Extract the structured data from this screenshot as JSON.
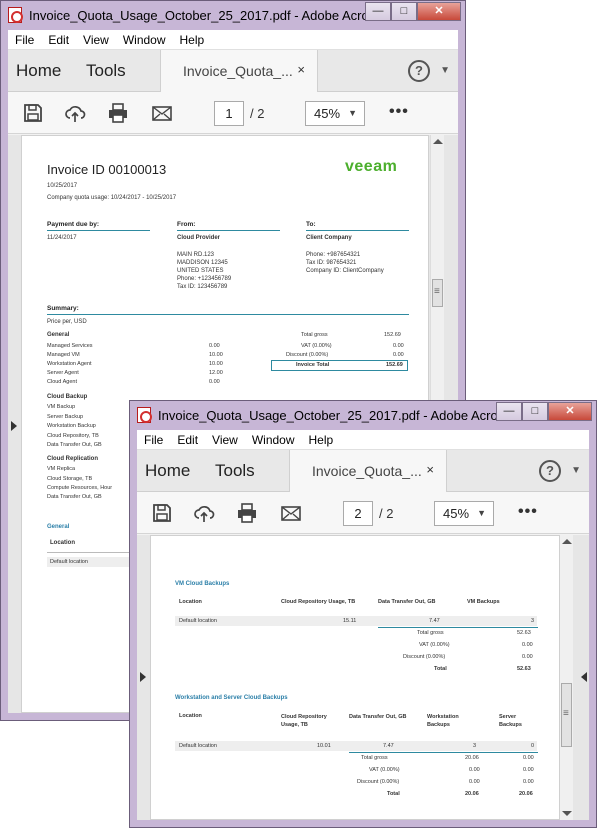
{
  "windows": [
    {
      "title": "Invoice_Quota_Usage_October_25_2017.pdf - Adobe Acroba...",
      "menu": [
        "File",
        "Edit",
        "View",
        "Window",
        "Help"
      ],
      "nav": {
        "home": "Home",
        "tools": "Tools",
        "tab_label": "Invoice_Quota_...",
        "tab_close": "×",
        "help": "?"
      },
      "toolbar": {
        "page_current": "1",
        "page_total": "/ 2",
        "zoom": "45%",
        "more": "•••"
      }
    },
    {
      "title": "Invoice_Quota_Usage_October_25_2017.pdf - Adobe Acroba...",
      "menu": [
        "File",
        "Edit",
        "View",
        "Window",
        "Help"
      ],
      "nav": {
        "home": "Home",
        "tools": "Tools",
        "tab_label": "Invoice_Quota_...",
        "tab_close": "×",
        "help": "?"
      },
      "toolbar": {
        "page_current": "2",
        "page_total": "/ 2",
        "zoom": "45%",
        "more": "•••"
      }
    }
  ],
  "window_buttons": {
    "minimize": "—",
    "maximize": "□",
    "close": "✕"
  },
  "page1": {
    "invoice_title": "Invoice ID 00100013",
    "logo": "veeam",
    "date": "10/25/2017",
    "quota_usage": "Company quota usage: 10/24/2017 - 10/25/2017",
    "payment_due_label": "Payment due by:",
    "payment_due_date": "11/24/2017",
    "from_label": "From:",
    "from_name": "Cloud Provider",
    "from_lines": [
      "MAIN RD.123",
      "MADDISON 12345",
      "UNITED STATES",
      "Phone: +123456789",
      "Tax ID: 123456789"
    ],
    "to_label": "To:",
    "to_name": "Client Company",
    "to_lines": [
      "Phone: +987654321",
      "Tax ID: 987654321",
      "Company ID: ClientCompany"
    ],
    "summary_label": "Summary:",
    "price_per": "Price per, USD",
    "general_label": "General",
    "general_items": [
      {
        "name": "Managed Services",
        "value": "0.00"
      },
      {
        "name": "Managed VM",
        "value": "10.00"
      },
      {
        "name": "Workstation Agent",
        "value": "10.00"
      },
      {
        "name": "Server Agent",
        "value": "12.00"
      },
      {
        "name": "Cloud Agent",
        "value": "0.00"
      }
    ],
    "totals": [
      {
        "name": "Total gross",
        "value": "152.69"
      },
      {
        "name": "VAT (0.00%)",
        "value": "0.00"
      },
      {
        "name": "Discount (0.00%)",
        "value": "0.00"
      }
    ],
    "invoice_total_label": "Invoice Total",
    "invoice_total_value": "152.69",
    "cloud_backup_label": "Cloud Backup",
    "cloud_backup_items": [
      "VM Backup",
      "Server Backup",
      "Workstation Backup",
      "Cloud Repository, TB",
      "Data Transfer Out, GB"
    ],
    "cloud_replication_label": "Cloud Replication",
    "cloud_replication_items": [
      "VM Replica",
      "Cloud Storage, TB",
      "Compute Resources, Hour",
      "Data Transfer Out, GB"
    ],
    "general2_label": "General",
    "location_label": "Location",
    "default_location": "Default location"
  },
  "page2": {
    "vm_section": "VM Cloud Backups",
    "vm_headers": [
      "Location",
      "Cloud Repository Usage, TB",
      "Data Transfer Out, GB",
      "VM Backups"
    ],
    "vm_row": [
      "Default location",
      "15.11",
      "7.47",
      "3"
    ],
    "vm_totals": [
      {
        "name": "Total gross",
        "value": "52.63"
      },
      {
        "name": "VAT (0.00%)",
        "value": "0.00"
      },
      {
        "name": "Discount (0.00%)",
        "value": "0.00"
      },
      {
        "name": "Total",
        "value": "52.63"
      }
    ],
    "ws_section": "Workstation and Server Cloud Backups",
    "ws_headers": [
      "Location",
      "Cloud Repository Usage, TB",
      "Data Transfer Out, GB",
      "Workstation Backups",
      "Server Backups"
    ],
    "ws_row": [
      "Default location",
      "10.01",
      "7.47",
      "3",
      "0"
    ],
    "ws_totals": [
      {
        "name": "Total gross",
        "v1": "20.06",
        "v2": "0.00"
      },
      {
        "name": "VAT (0.00%)",
        "v1": "0.00",
        "v2": "0.00"
      },
      {
        "name": "Discount (0.00%)",
        "v1": "0.00",
        "v2": "0.00"
      },
      {
        "name": "Total",
        "v1": "20.06",
        "v2": "20.06"
      }
    ]
  }
}
